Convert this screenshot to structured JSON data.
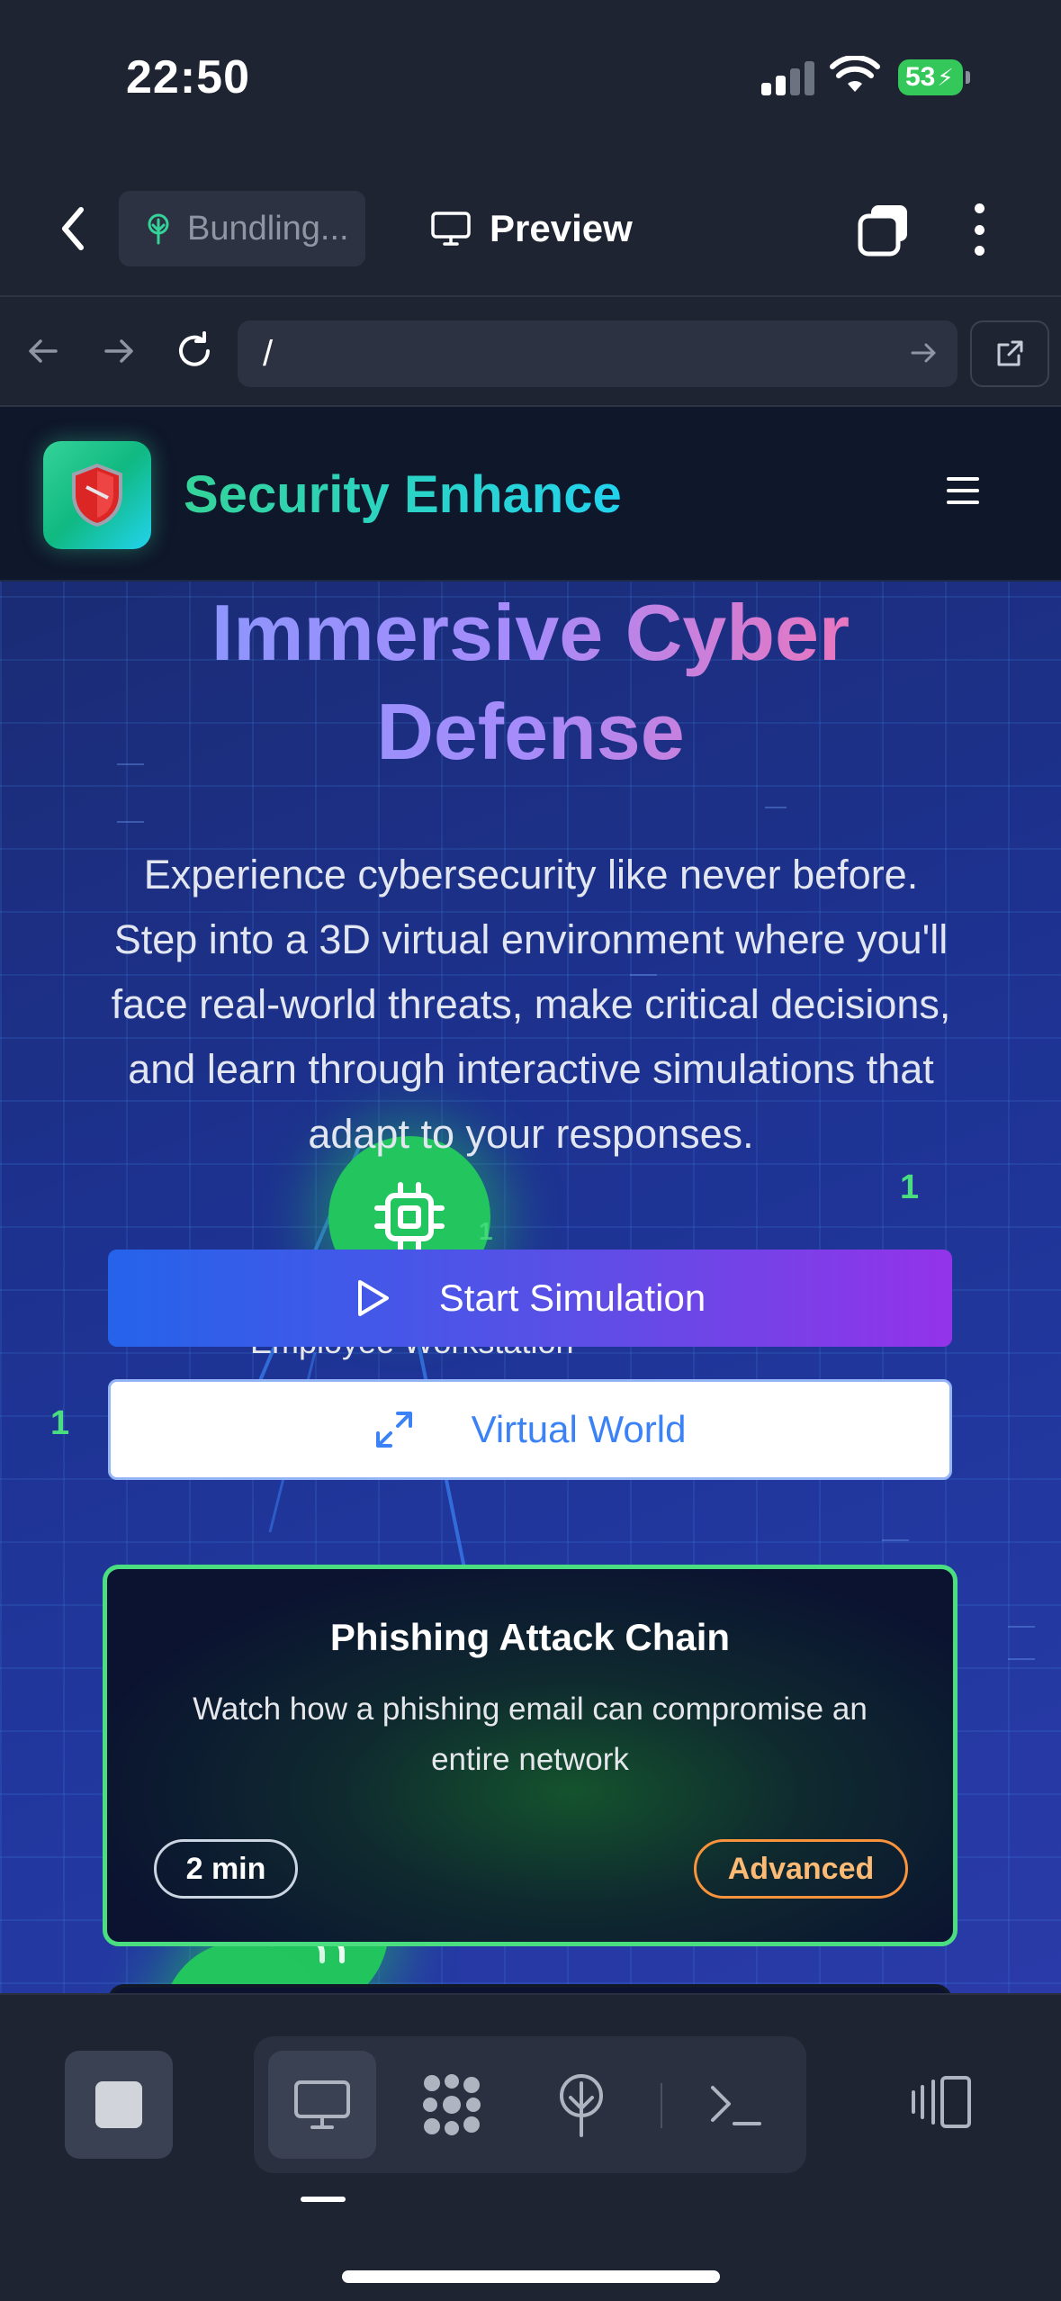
{
  "status_bar": {
    "time": "22:50",
    "battery": "53"
  },
  "app_header": {
    "bundling_label": "Bundling...",
    "preview_label": "Preview"
  },
  "url_bar": {
    "url": "/"
  },
  "site": {
    "brand": "Security Enhance",
    "hero_title_line1": "Immersive Cyber",
    "hero_title_line2": "Defense",
    "hero_description": "Experience cybersecurity like never before. Step into a 3D virtual environment where you'll face real-world threats, make critical decisions, and learn through interactive simulations that adapt to your responses.",
    "start_button": "Start Simulation",
    "world_button": "Virtual World",
    "node_label": "Employee Workstation",
    "node_count_right": "1",
    "node_count_left": "1",
    "node_count_small": "1"
  },
  "scenario_card": {
    "title": "Phishing Attack Chain",
    "description": "Watch how a phishing email can compromise an entire network",
    "duration": "2 min",
    "level": "Advanced"
  },
  "colors": {
    "accent_green": "#22c55e",
    "card_border": "#4ade80",
    "level_badge": "#fb923c",
    "button_gradient_start": "#2563eb",
    "button_gradient_end": "#9333ea"
  }
}
